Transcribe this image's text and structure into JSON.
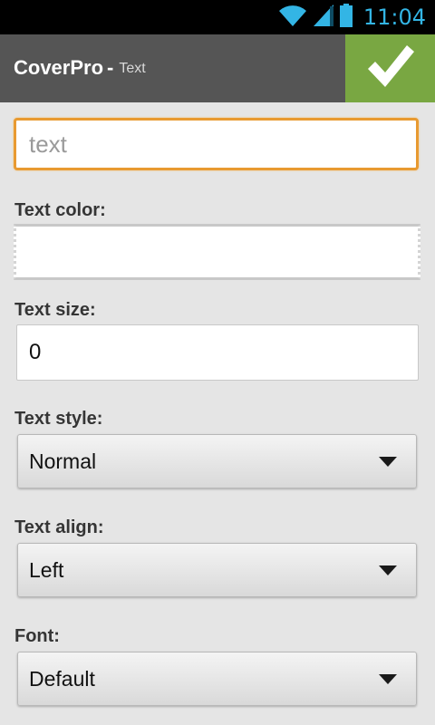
{
  "status_bar": {
    "time": "11:04",
    "icons": [
      "wifi-icon",
      "signal-icon",
      "battery-icon"
    ],
    "accent_color": "#33b5e5"
  },
  "action_bar": {
    "title": "CoverPro",
    "separator": "-",
    "subtitle": "Text",
    "background_color": "#555555",
    "confirm_button": {
      "icon": "checkmark-icon",
      "background_color": "#79a742"
    }
  },
  "form": {
    "text_input": {
      "value": "",
      "placeholder": "text",
      "focus_color": "#e89a31"
    },
    "text_color": {
      "label": "Text color:",
      "value": "#ffffff"
    },
    "text_size": {
      "label": "Text size:",
      "value": "0"
    },
    "text_style": {
      "label": "Text style:",
      "selected": "Normal"
    },
    "text_align": {
      "label": "Text align:",
      "selected": "Left"
    },
    "font": {
      "label": "Font:",
      "selected": "Default"
    }
  }
}
